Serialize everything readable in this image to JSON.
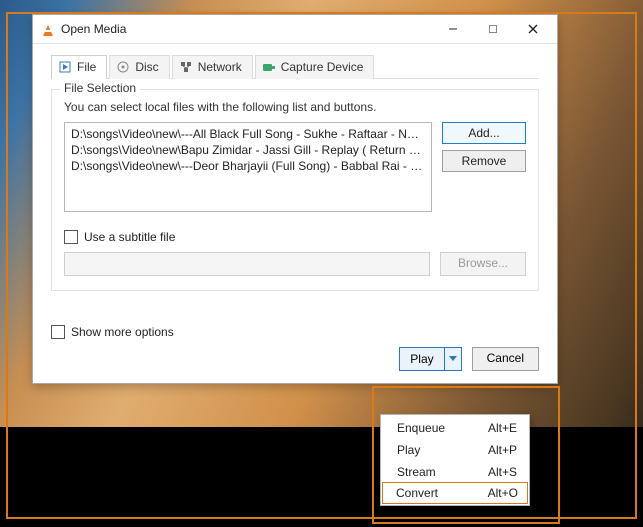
{
  "window": {
    "title": "Open Media"
  },
  "tabs": {
    "file": "File",
    "disc": "Disc",
    "network": "Network",
    "capture": "Capture Device"
  },
  "file_selection": {
    "group_label": "File Selection",
    "instruction": "You can select local files with the following list and buttons.",
    "files": [
      "D:\\songs\\Video\\new\\---All Black Full Song - Sukhe - Raftaar -  New ...",
      "D:\\songs\\Video\\new\\Bapu Zimidar - Jassi Gill - Replay ( Return Of M...",
      "D:\\songs\\Video\\new\\---Deor Bharjayii (Full Song) - Babbal Rai - Late..."
    ],
    "add_label": "Add...",
    "remove_label": "Remove"
  },
  "subtitle": {
    "checkbox_label": "Use a subtitle file",
    "browse_label": "Browse..."
  },
  "more_options_label": "Show more options",
  "footer": {
    "play_label": "Play",
    "cancel_label": "Cancel"
  },
  "play_menu": [
    {
      "label": "Enqueue",
      "shortcut": "Alt+E"
    },
    {
      "label": "Play",
      "shortcut": "Alt+P"
    },
    {
      "label": "Stream",
      "shortcut": "Alt+S"
    },
    {
      "label": "Convert",
      "shortcut": "Alt+O"
    }
  ]
}
